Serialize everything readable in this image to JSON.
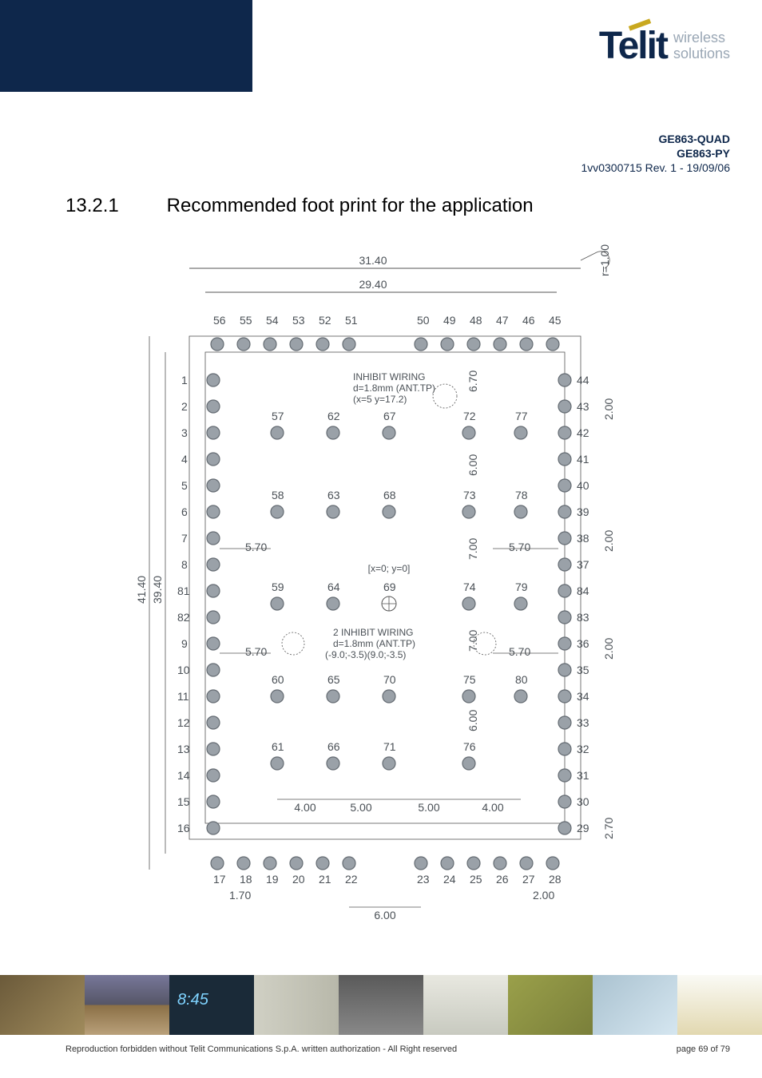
{
  "logo": {
    "brand": "Telit",
    "sub1": "wireless",
    "sub2": "solutions"
  },
  "doc": {
    "l1": "GE863-QUAD",
    "l2": "GE863-PY",
    "l3": "1vv0300715 Rev. 1 - 19/09/06"
  },
  "heading": {
    "num": "13.2.1",
    "title": "Recommended foot print for the application"
  },
  "diagram": {
    "top_dims": [
      "31.40",
      "29.40"
    ],
    "pins_top": [
      "56",
      "55",
      "54",
      "53",
      "52",
      "51",
      "50",
      "49",
      "48",
      "47",
      "46",
      "45"
    ],
    "pins_left": [
      "1",
      "2",
      "3",
      "4",
      "5",
      "6",
      "7",
      "8",
      "81",
      "82",
      "9",
      "10",
      "11",
      "12",
      "13",
      "14",
      "15",
      "16"
    ],
    "pins_right": [
      "44",
      "43",
      "42",
      "41",
      "40",
      "39",
      "38",
      "37",
      "84",
      "83",
      "36",
      "35",
      "34",
      "33",
      "32",
      "31",
      "30",
      "29"
    ],
    "pins_bottom": [
      "17",
      "18",
      "19",
      "20",
      "21",
      "22",
      "23",
      "24",
      "25",
      "26",
      "27",
      "28"
    ],
    "inner_a": [
      "57",
      "62",
      "67",
      "72",
      "77"
    ],
    "inner_b": [
      "58",
      "63",
      "68",
      "73",
      "78"
    ],
    "inner_c": [
      "59",
      "64",
      "69",
      "74",
      "79"
    ],
    "inner_d": [
      "60",
      "65",
      "70",
      "75",
      "80"
    ],
    "inner_e": [
      "61",
      "66",
      "71",
      "76"
    ],
    "notes": {
      "inhibit1_l1": "INHIBIT WIRING",
      "inhibit1_l2": "d=1.8mm (ANT.TP)",
      "inhibit1_l3": "(x=5 y=17.2)",
      "inhibit2_l1": "2 INHIBIT WIRING",
      "inhibit2_l2": "d=1.8mm (ANT.TP)",
      "inhibit2_l3": "(-9.0;-3.5)(9.0;-3.5)",
      "origin": "[x=0; y=0]"
    },
    "dims": {
      "r": "r=1.00",
      "side_h_outer": "41.40",
      "side_h_inner": "39.40",
      "bottom_w": "6.00",
      "bottom_corner_l": "1.70",
      "bottom_corner_r": "2.00",
      "bottom_spans": [
        "4.00",
        "5.00",
        "5.00",
        "4.00"
      ],
      "top_gap_a": "6.70",
      "row_gap_1": "6.00",
      "row_gap_2": "7.00",
      "row_gap_3": "7.00",
      "row_gap_4": "6.00",
      "right_pitch": "2.00",
      "right_bottom": "2.70",
      "inner_span": "5.70"
    }
  },
  "footer": {
    "copyright": "Reproduction forbidden without Telit Communications S.p.A. written authorization - All Right reserved",
    "page": "page 69 of 79"
  }
}
